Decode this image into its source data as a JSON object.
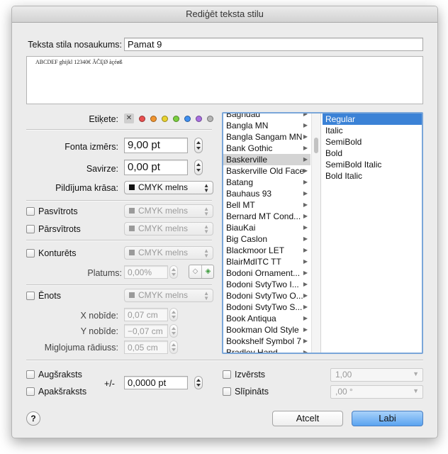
{
  "window": {
    "title": "Rediģēt teksta stilu"
  },
  "style_name": {
    "label": "Teksta stila nosaukums:",
    "value": "Pamat 9"
  },
  "preview": {
    "text": "ABCDEF ghijkl 12340€ ÄĈĘØ àçéøß"
  },
  "tags": {
    "label": "Etiķete:",
    "clear_symbol": "✕",
    "colors": [
      "#e84f4f",
      "#f0942f",
      "#e8d22f",
      "#7bcf3f",
      "#3f8ff0",
      "#a86fe0",
      "#b5b5b5"
    ]
  },
  "font_size": {
    "label": "Fonta izmērs:",
    "value": "9,00 pt"
  },
  "kerning": {
    "label": "Savirze:",
    "value": "0,00 pt"
  },
  "fill_color": {
    "label": "Pildījuma krāsa:",
    "value": "CMYK melns"
  },
  "underline": {
    "label": "Pasvītrots",
    "color": "CMYK melns"
  },
  "strikethrough": {
    "label": "Pārsvītrots",
    "color": "CMYK melns"
  },
  "outline": {
    "label": "Konturēts",
    "color": "CMYK melns",
    "width_label": "Platums:",
    "width_value": "0,00%"
  },
  "shadow": {
    "label": "Ēnots",
    "color": "CMYK melns",
    "x_offset_label": "X nobīde:",
    "x_offset_value": "0,07 cm",
    "y_offset_label": "Y nobīde:",
    "y_offset_value": "−0,07 cm",
    "blur_label": "Miglojuma rādiuss:",
    "blur_value": "0,05 cm"
  },
  "fonts": {
    "families": [
      "Baghdad",
      "Bangla MN",
      "Bangla Sangam MN",
      "Bank Gothic",
      "Baskerville",
      "Baskerville Old Face",
      "Batang",
      "Bauhaus 93",
      "Bell MT",
      "Bernard MT Cond...",
      "BiauKai",
      "Big Caslon",
      "Blackmoor LET",
      "BlairMdITC TT",
      "Bodoni Ornament...",
      "Bodoni SvtyTwo I...",
      "Bodoni SvtyTwo O...",
      "Bodoni SvtyTwo S...",
      "Book Antiqua",
      "Bookman Old Style",
      "Bookshelf Symbol 7",
      "Bradley Hand"
    ],
    "selected_family": "Baskerville",
    "styles": [
      "Regular",
      "Italic",
      "SemiBold",
      "Bold",
      "SemiBold Italic",
      "Bold Italic"
    ],
    "selected_style": "Regular"
  },
  "superscript": {
    "label": "Augšraksts"
  },
  "subscript": {
    "label": "Apakšraksts"
  },
  "baseline": {
    "label": "+/-",
    "value": "0,0000 pt"
  },
  "expanded": {
    "label": "Izvērsts",
    "value": "1,00"
  },
  "italic": {
    "label": "Slīpināts",
    "value": ",00 °"
  },
  "buttons": {
    "help": "?",
    "cancel": "Atcelt",
    "ok": "Labi"
  }
}
